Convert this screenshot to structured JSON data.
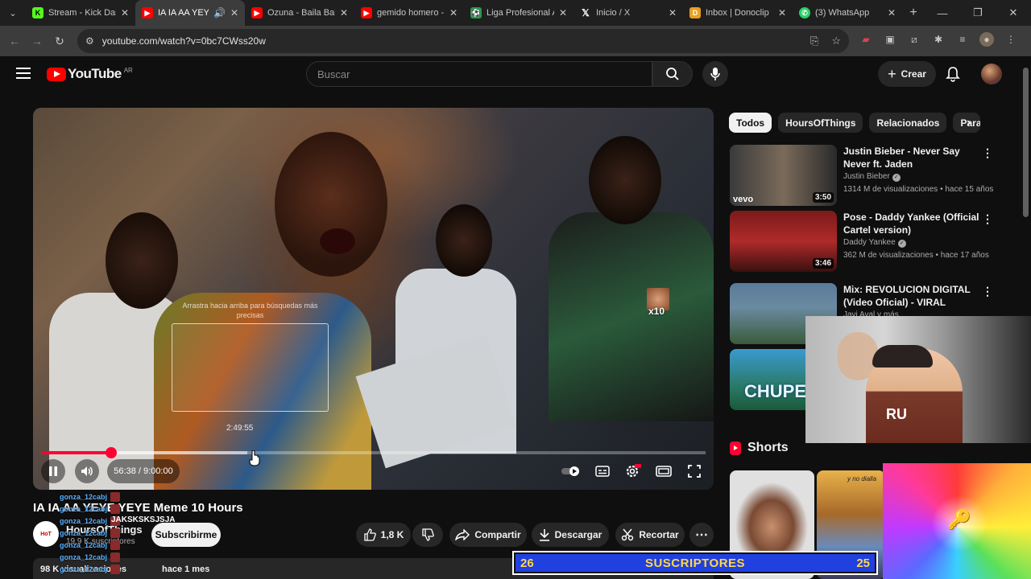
{
  "browser": {
    "tabs": [
      {
        "title": "Stream - Kick Dash",
        "favicon": "kick-icon",
        "color": "#53fc18",
        "active": false
      },
      {
        "title": "IA IA AA YEYE",
        "favicon": "youtube-icon",
        "color": "#ff0000",
        "active": true
      },
      {
        "title": "Ozuna - Baila Baila",
        "favicon": "youtube-icon",
        "color": "#ff0000",
        "active": false
      },
      {
        "title": "gemido homero -",
        "favicon": "youtube-icon",
        "color": "#ff0000",
        "active": false
      },
      {
        "title": "Liga Profesional A",
        "favicon": "liga-icon",
        "color": "#2a9a4a",
        "active": false
      },
      {
        "title": "Inicio / X",
        "favicon": "x-icon",
        "color": "#000000",
        "active": false
      },
      {
        "title": "Inbox | Donoclip",
        "favicon": "donoclip-icon",
        "color": "#e8a020",
        "active": false
      },
      {
        "title": "(3) WhatsApp",
        "favicon": "whatsapp-icon",
        "color": "#25d366",
        "active": false
      }
    ],
    "url": "youtube.com/watch?v=0bc7CWss20w"
  },
  "youtube": {
    "logo_text": "YouTube",
    "country_code": "AR",
    "search_placeholder": "Buscar",
    "create_label": "Crear"
  },
  "player": {
    "time_current": "56:38",
    "time_total": "9:00:00",
    "time_display": "56:38 / 9:00:00",
    "progress": 0.105,
    "buffered": 0.31,
    "hover_time": "2:49:55",
    "drag_hint": "Arrastra hacia arriba para búsquedas más precisas",
    "overlay_multiplier": "x10"
  },
  "video": {
    "title": "IA IA AA YEYE YEYE Meme 10 Hours",
    "channel": "HoursOfThings",
    "subscribers": "19,9 K suscriptores",
    "subscribe_label": "Subscribirme",
    "likes": "1,8 K",
    "share_label": "Compartir",
    "download_label": "Descargar",
    "clip_label": "Recortar",
    "views": "98 K visualizaciones",
    "date": "hace 1 mes"
  },
  "chat_overlay": {
    "user": "gonza_12cabj",
    "message": "JAKSKSKSJSJA",
    "repeats": 7
  },
  "chips": [
    {
      "label": "Todos",
      "selected": true
    },
    {
      "label": "HoursOfThings",
      "selected": false
    },
    {
      "label": "Relacionados",
      "selected": false
    },
    {
      "label": "Para ti",
      "selected": false
    }
  ],
  "recommendations": [
    {
      "title": "Justin Bieber - Never Say Never ft. Jaden",
      "channel": "Justin Bieber",
      "verified": true,
      "views": "1314 M de visualizaciones • hace 15 años",
      "duration": "3:50",
      "thumb_badge": "vevo"
    },
    {
      "title": "Pose - Daddy Yankee (Official Cartel version)",
      "channel": "Daddy Yankee",
      "verified": true,
      "views": "362 M de visualizaciones • hace 17 años",
      "duration": "3:46",
      "thumb_badge": ""
    },
    {
      "title": "Mix: REVOLUCION DIGITAL (Video Oficial) - VIRAL",
      "channel": "Javi Aval y más",
      "verified": false,
      "views": "",
      "duration": "",
      "thumb_badge": ""
    },
    {
      "title": "",
      "channel": "",
      "verified": false,
      "views": "",
      "duration": "",
      "thumb_badge": "CHUPE"
    }
  ],
  "shorts": {
    "heading": "Shorts",
    "short2_tag": "y no dialla"
  },
  "stream_overlay": {
    "sub_left": "26",
    "sub_label": "SUSCRIPTORES",
    "sub_right": "25",
    "webcam_shirt": "RU"
  }
}
